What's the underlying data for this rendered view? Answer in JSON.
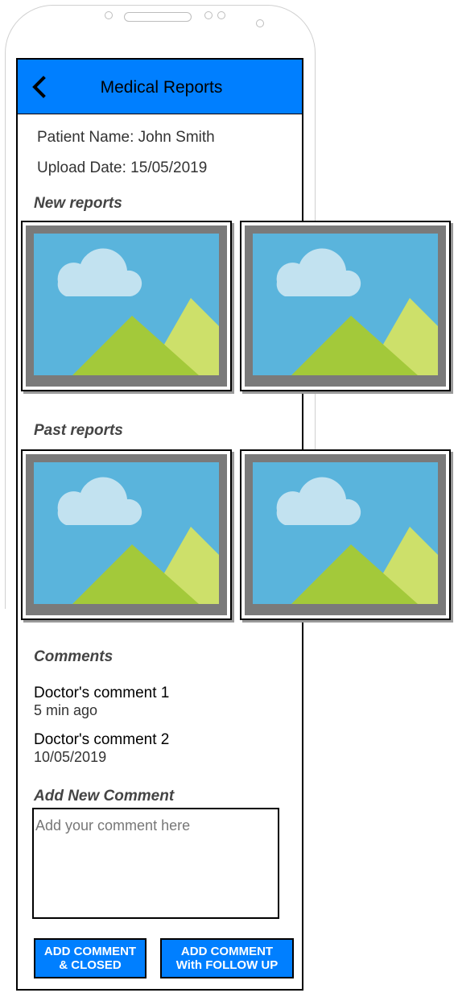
{
  "header": {
    "title": "Medical Reports",
    "back_icon": "chevron-left-icon"
  },
  "patient": {
    "name_line": "Patient Name: John Smith",
    "upload_line": "Upload Date: 15/05/2019"
  },
  "sections": {
    "new_reports": "New reports",
    "past_reports": "Past reports",
    "comments": "Comments",
    "add_comment": "Add New Comment"
  },
  "reports": {
    "new": [
      {
        "icon": "image-placeholder-icon"
      },
      {
        "icon": "image-placeholder-icon"
      }
    ],
    "past": [
      {
        "icon": "image-placeholder-icon"
      },
      {
        "icon": "image-placeholder-icon"
      }
    ]
  },
  "comments": [
    {
      "text": "Doctor's comment 1",
      "time": "5 min ago"
    },
    {
      "text": "Doctor's comment 2",
      "time": "10/05/2019"
    }
  ],
  "input": {
    "placeholder": "Add your comment here",
    "value": ""
  },
  "buttons": {
    "closed_line1": "ADD COMMENT",
    "closed_line2": "& CLOSED",
    "follow_line1": "ADD COMMENT",
    "follow_line2": "With FOLLOW UP"
  },
  "colors": {
    "accent": "#007fff",
    "frame": "#7a7a7a",
    "sky": "#5ab4dc",
    "hill_front": "#a3c93a",
    "hill_back": "#cde06a",
    "cloud": "#c2e2f0"
  }
}
